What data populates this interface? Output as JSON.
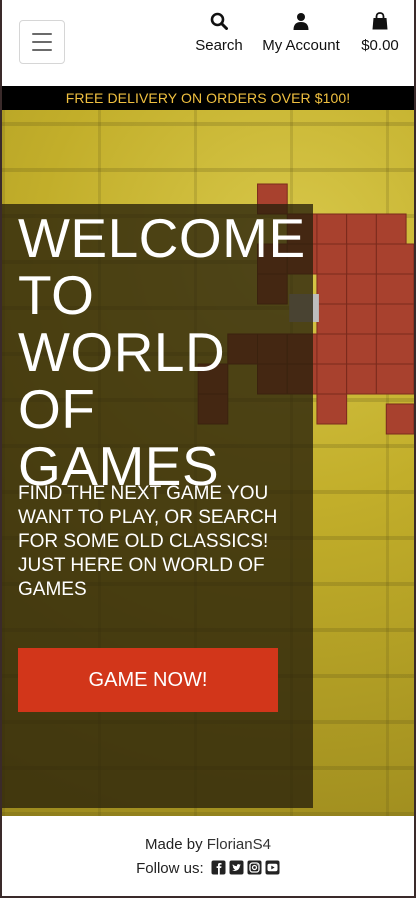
{
  "header": {
    "search_label": "Search",
    "account_label": "My Account",
    "bag_total": "$0.00",
    "menu_icon": "hamburger-menu-icon",
    "search_icon": "search-icon",
    "account_icon": "user-icon",
    "bag_icon": "shopping-bag-icon"
  },
  "promo": {
    "text": "FREE DELIVERY ON ORDERS OVER $100!"
  },
  "hero": {
    "title": "WELCOME TO WORLD OF GAMES",
    "subtitle": "FIND THE NEXT GAME YOU WANT TO PLAY, OR SEARCH FOR SOME OLD CLASSICS! JUST HERE ON WORLD OF GAMES",
    "cta_label": "GAME NOW!"
  },
  "footer": {
    "made_by_prefix": "Made by",
    "author": "FlorianS4",
    "follow_label": "Follow us:",
    "social_icons": [
      "facebook-icon",
      "twitter-icon",
      "instagram-icon",
      "youtube-icon"
    ]
  },
  "colors": {
    "promo_text": "#f0c040",
    "cta_background": "#d2361a",
    "overlay": "rgba(40,32,10,0.78)"
  }
}
